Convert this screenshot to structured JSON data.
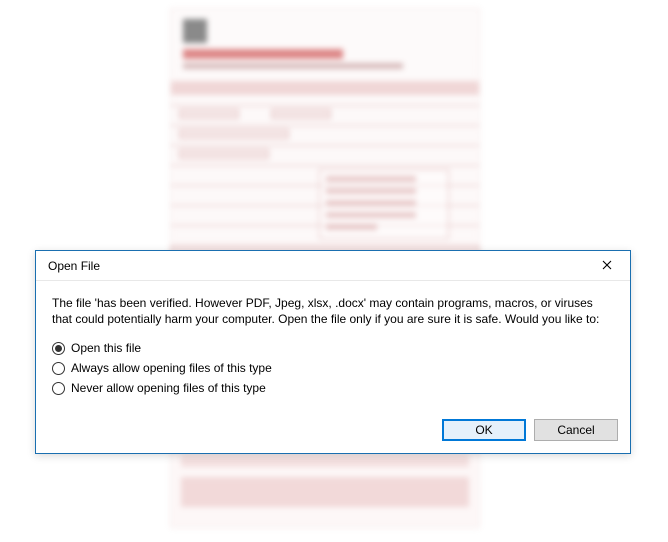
{
  "dialog": {
    "title": "Open File",
    "message": "The file 'has been verified. However PDF, Jpeg, xlsx, .docx' may contain programs, macros, or viruses that could potentially harm your computer. Open the file only if you are sure it is safe. Would you like to:",
    "options": [
      {
        "label": "Open this file",
        "selected": true
      },
      {
        "label": "Always allow opening files of this type",
        "selected": false
      },
      {
        "label": "Never allow opening files of this type",
        "selected": false
      }
    ],
    "buttons": {
      "ok": "OK",
      "cancel": "Cancel"
    }
  }
}
